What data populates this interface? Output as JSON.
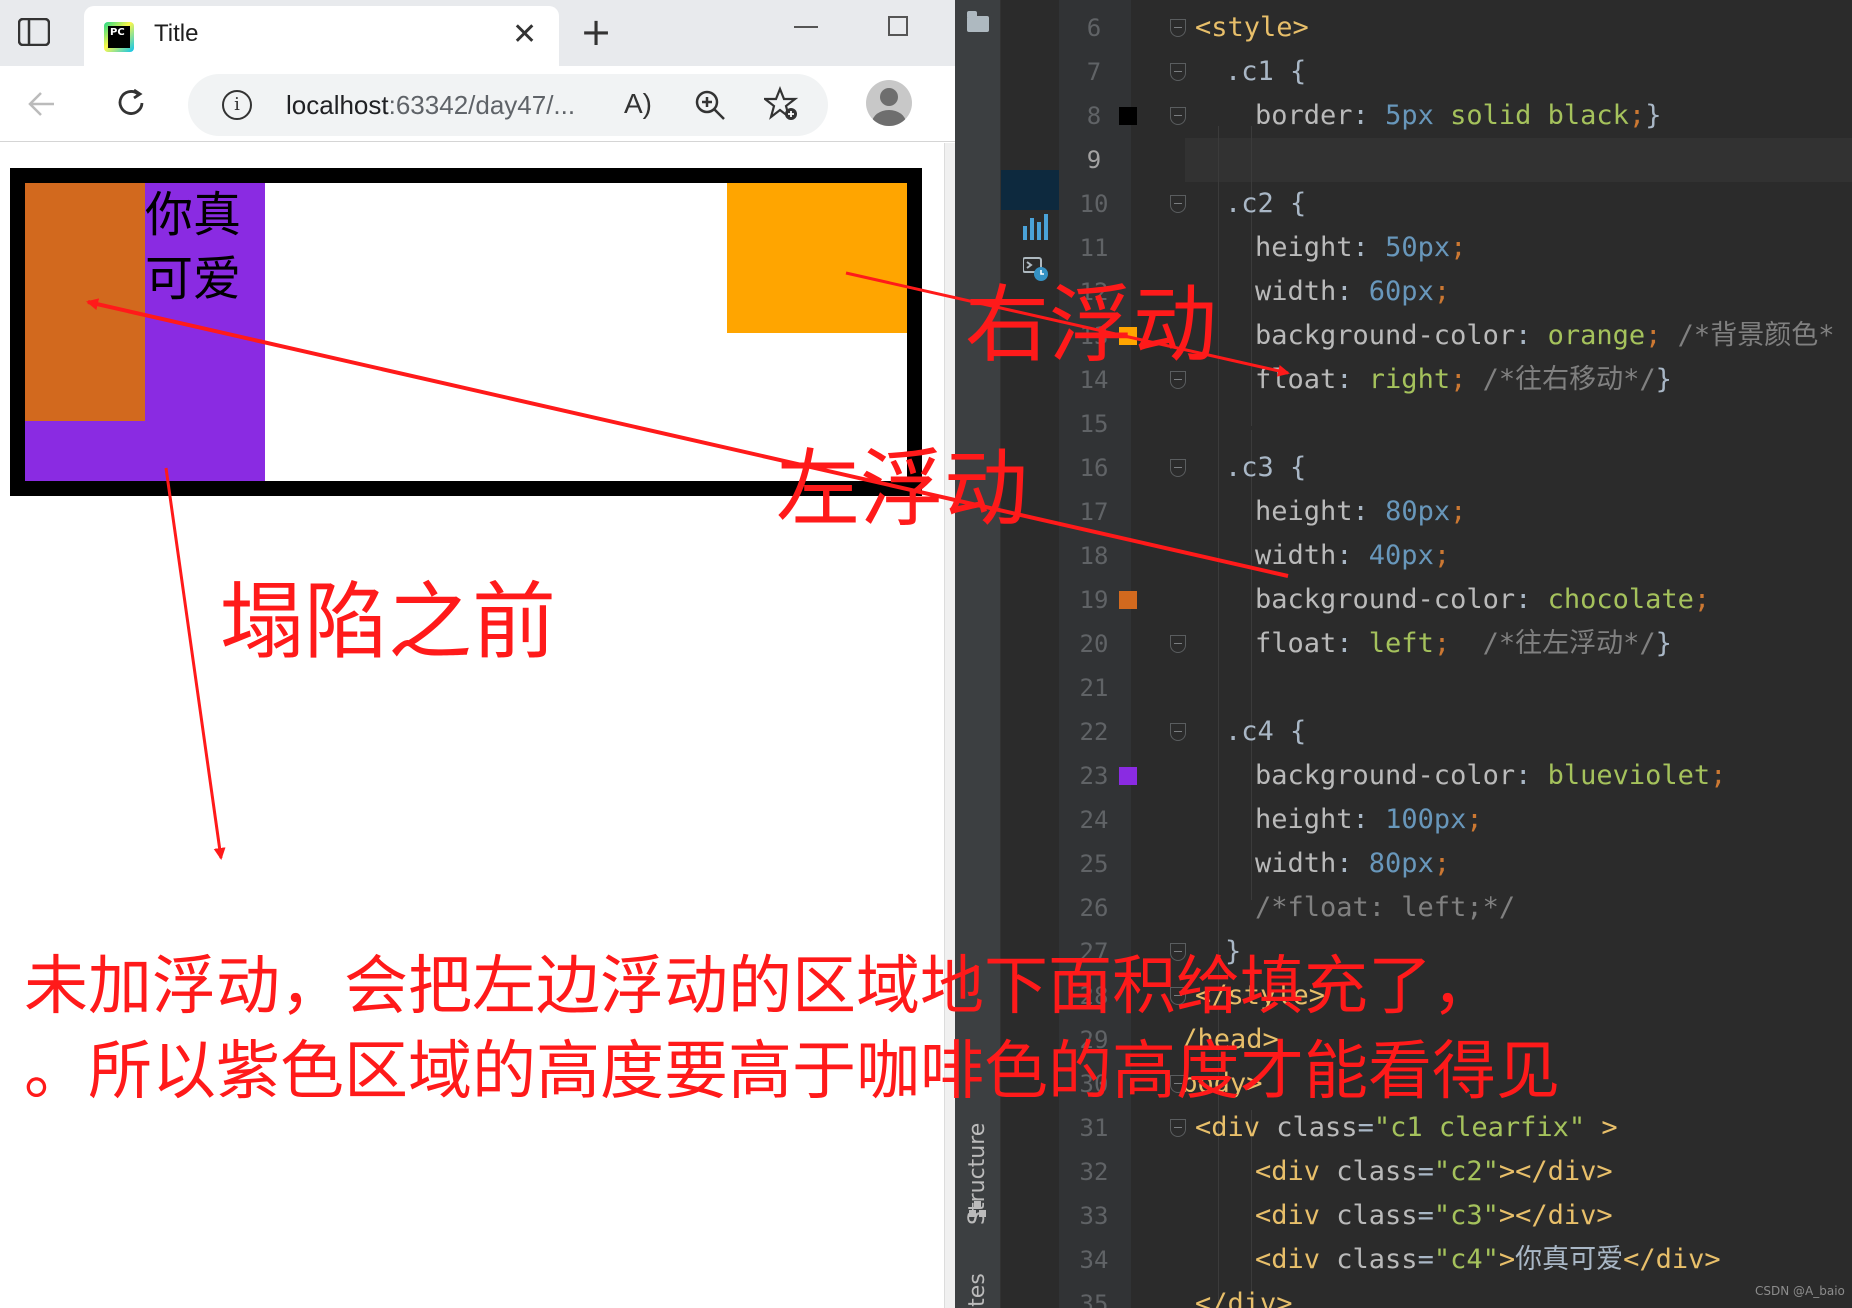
{
  "browser": {
    "tab_title": "Title",
    "tab_close": "✕",
    "new_tab": "+",
    "favicon_text": "PC",
    "url_host": "localhost",
    "url_rest": ":63342/day47/...",
    "read_aloud": "A)",
    "icons": [
      "sidebar-icon",
      "back-arrow-icon",
      "reload-icon",
      "info-icon",
      "read-aloud-icon",
      "zoom-icon",
      "favorite-icon",
      "profile-avatar"
    ]
  },
  "demo": {
    "c4_text": "你真可爱",
    "colors": {
      "border": "#000000",
      "c2": "#ffa500",
      "c3": "#d2691e",
      "c4": "#8a2be2"
    }
  },
  "ide": {
    "structure_label": "Structure",
    "favorites_label": "rites",
    "watermark": "CSDN @A_baio",
    "line_numbers": [
      "6",
      "7",
      "8",
      "9",
      "10",
      "11",
      "12",
      "13",
      "14",
      "15",
      "16",
      "17",
      "18",
      "19",
      "20",
      "21",
      "22",
      "23",
      "24",
      "25",
      "26",
      "27",
      "28",
      "29",
      "30",
      "31",
      "32",
      "33",
      "34",
      "35"
    ],
    "code": {
      "l6": {
        "tag": "<style>"
      },
      "l7": {
        "sel": ".c1",
        "brace": " {"
      },
      "l8": {
        "prop": "border",
        "colon": ": ",
        "num": "5px",
        "kw": " solid black",
        "semi": ";",
        "end": "}"
      },
      "l10": {
        "sel": ".c2",
        "brace": " {"
      },
      "l11": {
        "prop": "height",
        "colon": ": ",
        "num": "50px",
        "semi": ";"
      },
      "l12": {
        "prop": "width",
        "colon": ": ",
        "num": "60px",
        "semi": ";"
      },
      "l13": {
        "prop": "background-color",
        "colon": ": ",
        "kw": "orange",
        "semi": ";",
        "cmt": " /*背景颜色*"
      },
      "l14": {
        "prop": "float",
        "colon": ": ",
        "kw": "right",
        "semi": ";",
        "cmt": " /*往右移动*/",
        "end": "}"
      },
      "l16": {
        "sel": ".c3",
        "brace": " {"
      },
      "l17": {
        "prop": "height",
        "colon": ": ",
        "num": "80px",
        "semi": ";"
      },
      "l18": {
        "prop": "width",
        "colon": ": ",
        "num": "40px",
        "semi": ";"
      },
      "l19": {
        "prop": "background-color",
        "colon": ": ",
        "kw": "chocolate",
        "semi": ";"
      },
      "l20": {
        "prop": "float",
        "colon": ": ",
        "kw": "left",
        "semi": ";",
        "cmt": "  /*往左浮动*/",
        "end": "}"
      },
      "l22": {
        "sel": ".c4",
        "brace": " {"
      },
      "l23": {
        "prop": "background-color",
        "colon": ": ",
        "kw": "blueviolet",
        "semi": ";"
      },
      "l24": {
        "prop": "height",
        "colon": ": ",
        "num": "100px",
        "semi": ";"
      },
      "l25": {
        "prop": "width",
        "colon": ": ",
        "num": "80px",
        "semi": ";"
      },
      "l26": {
        "cmt": "/*float: left;*/"
      },
      "l27": {
        "end": "}"
      },
      "l28": {
        "tag": "</style>"
      },
      "l29": {
        "tag": "</head>"
      },
      "l30": {
        "tag": "<body>"
      },
      "l31": {
        "open": "<div ",
        "attr": "class",
        "eq": "=",
        "str": "\"c1 clearfix\"",
        "close": " >"
      },
      "l32": {
        "open": "<div ",
        "attr": "class",
        "eq": "=",
        "str": "\"c2\"",
        "close": "></div>"
      },
      "l33": {
        "open": "<div ",
        "attr": "class",
        "eq": "=",
        "str": "\"c3\"",
        "close": "></div>"
      },
      "l34": {
        "open": "<div ",
        "attr": "class",
        "eq": "=",
        "str": "\"c4\"",
        "close": ">",
        "text": "你真可爱",
        "end": "</div>"
      },
      "l35": {
        "tag": "</div>"
      }
    },
    "swatch_colors": {
      "l8": "#000000",
      "l13": "#ffa500",
      "l19": "#d2691e",
      "l23": "#8a2be2"
    }
  },
  "annotations": {
    "right_float": "右浮动",
    "left_float": "左浮动",
    "before_collapse": "塌陷之前",
    "note_line1": "未加浮动，会把左边浮动的区域地下面积给填充了，",
    "note_line2": "。所以紫色区域的高度要高于咖啡色的高度才能看得见",
    "color": "#ff1a1a"
  }
}
